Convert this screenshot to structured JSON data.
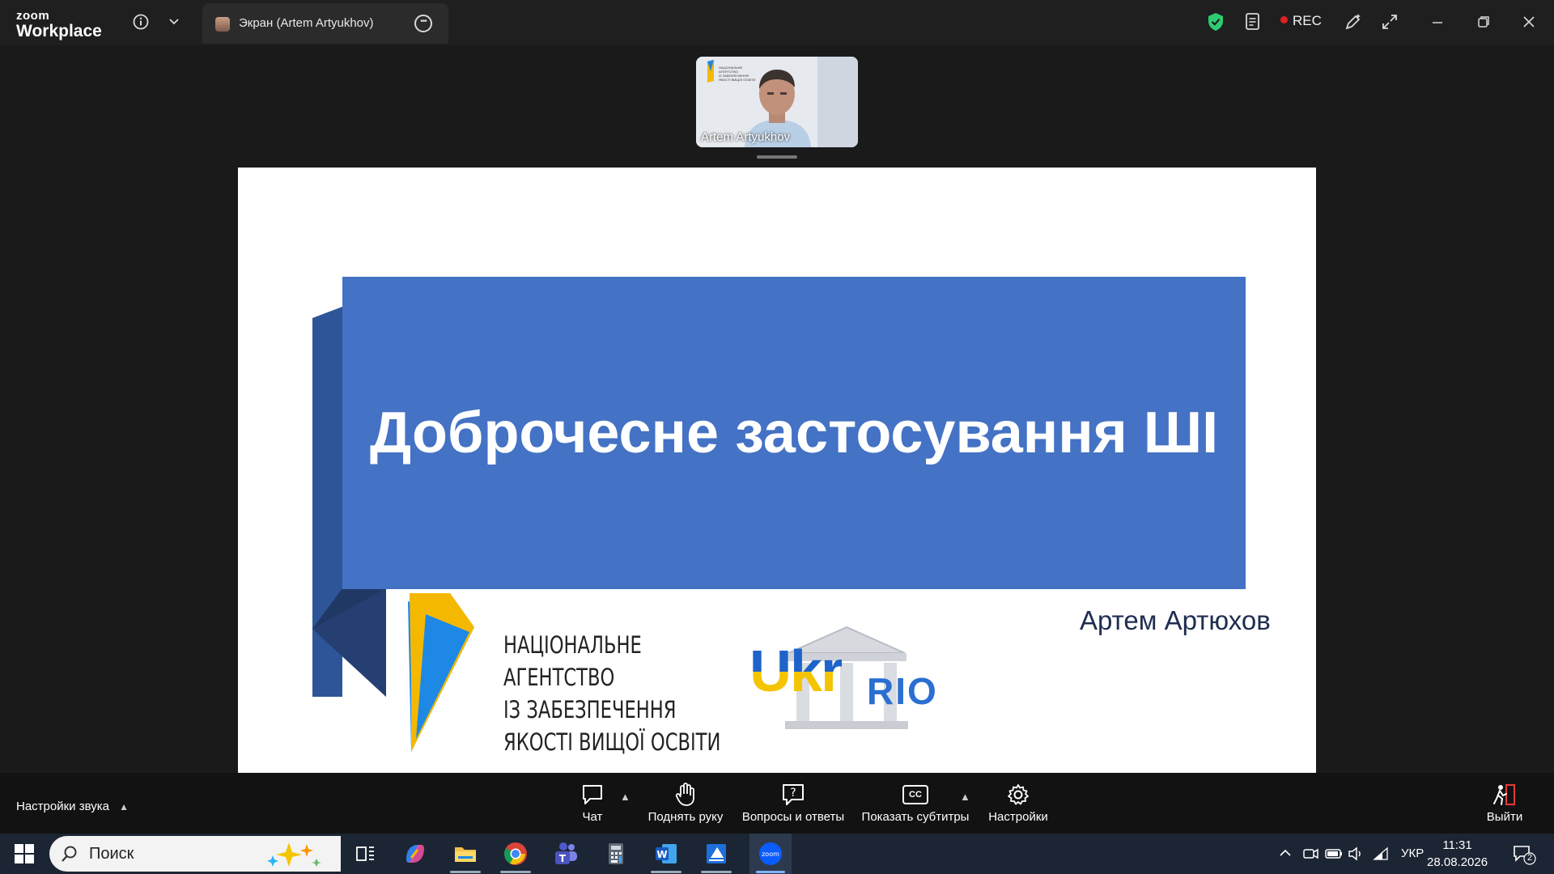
{
  "titlebar": {
    "brand_zoom": "zoom",
    "brand_workplace": "Workplace",
    "tab_label": "Экран (Artem Artyukhov)",
    "rec_label": "REC"
  },
  "video": {
    "participant_name": "Artem Artyukhov"
  },
  "slide": {
    "title": "Доброчесне застосування ШІ",
    "author": "Артем Артюхов",
    "org_lines": [
      "НАЦІОНАЛЬНЕ",
      "АГЕНТСТВО",
      "ІЗ ЗАБЕЗПЕЧЕННЯ",
      "ЯКОСТІ ВИЩОЇ ОСВІТИ"
    ],
    "logo_ukr": "Ukr",
    "logo_rio": "RIO",
    "thumb_org_lines": [
      "НАЦІОНАЛЬНЕ",
      "АГЕНТСТВО",
      "ІЗ ЗАБЕЗПЕЧЕННЯ",
      "ЯКОСТІ ВИЩОЇ ОСВІТИ"
    ]
  },
  "toolbar": {
    "audio_settings": "Настройки звука",
    "chat": "Чат",
    "raise_hand": "Поднять руку",
    "qa": "Вопросы и ответы",
    "captions": "Показать субтитры",
    "captions_icon_text": "CC",
    "settings": "Настройки",
    "leave": "Выйти"
  },
  "taskbar": {
    "search_label": "Поиск",
    "language": "УКР",
    "time": "11:31",
    "date": "28.08.2026",
    "notification_count": "2",
    "zoom_app_text": "zoom",
    "word_letter": "W"
  },
  "colors": {
    "title_block": "#4472c4",
    "title_block_dark": "#2e5597",
    "title_block_darker": "#203864",
    "naqa_blue": "#1e88e5",
    "naqa_yellow": "#f5b800",
    "shield_green": "#2ecc71"
  }
}
